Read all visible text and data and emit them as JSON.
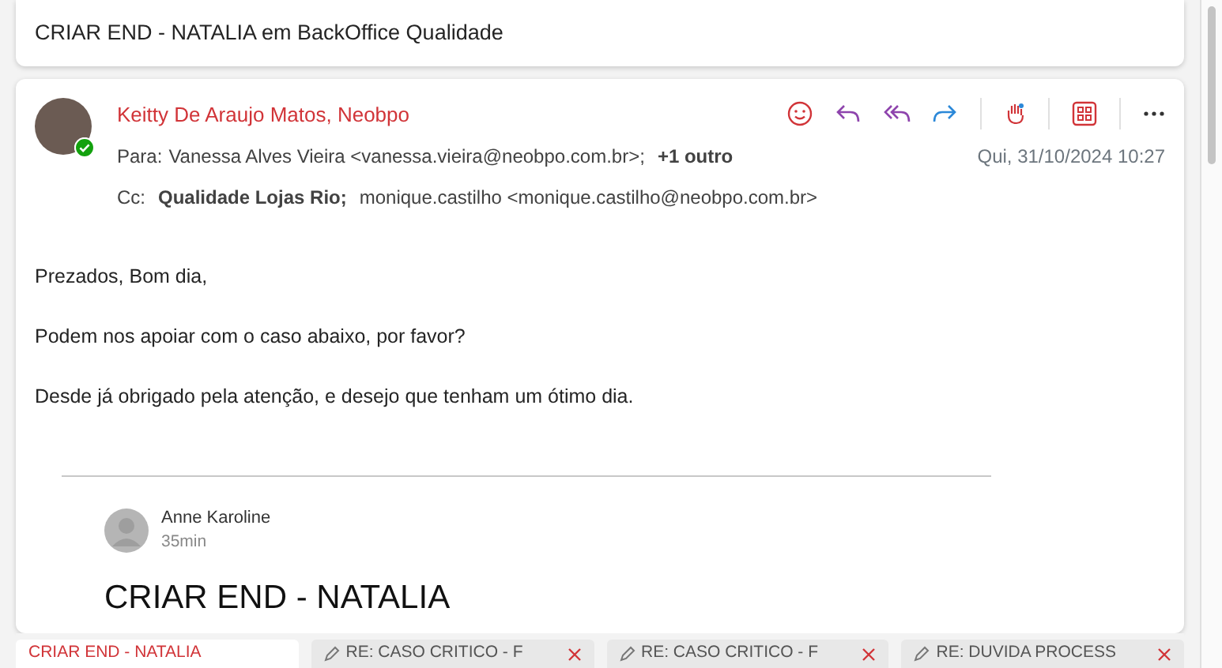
{
  "title": "CRIAR END - NATALIA em BackOffice Qualidade",
  "message": {
    "sender": "Keitty De Araujo Matos, Neobpo",
    "online": true,
    "to_label": "Para:",
    "to": "Vanessa Alves Vieira <vanessa.vieira@neobpo.com.br>;",
    "to_more": "+1 outro",
    "date": "Qui, 31/10/2024 10:27",
    "cc_label": "Cc:",
    "cc": [
      {
        "text": "Qualidade Lojas Rio;",
        "bold": true
      },
      {
        "text": "monique.castilho <monique.castilho@neobpo.com.br>",
        "bold": false
      }
    ],
    "body": [
      "Prezados, Bom dia,",
      "Podem nos apoiar com o caso abaixo, por favor?",
      "Desde já obrigado pela atenção, e desejo que tenham um ótimo dia."
    ],
    "quoted": {
      "author": "Anne Karoline",
      "time": "35min",
      "heading": "CRIAR END - NATALIA"
    }
  },
  "tabs": [
    {
      "label": "CRIAR END - NATALIA",
      "selected": true,
      "draft": false
    },
    {
      "label": "RE: CASO CRITICO - F",
      "selected": false,
      "draft": true
    },
    {
      "label": "RE: CASO CRITICO - F",
      "selected": false,
      "draft": true
    },
    {
      "label": "RE: DUVIDA PROCESS",
      "selected": false,
      "draft": true
    }
  ]
}
